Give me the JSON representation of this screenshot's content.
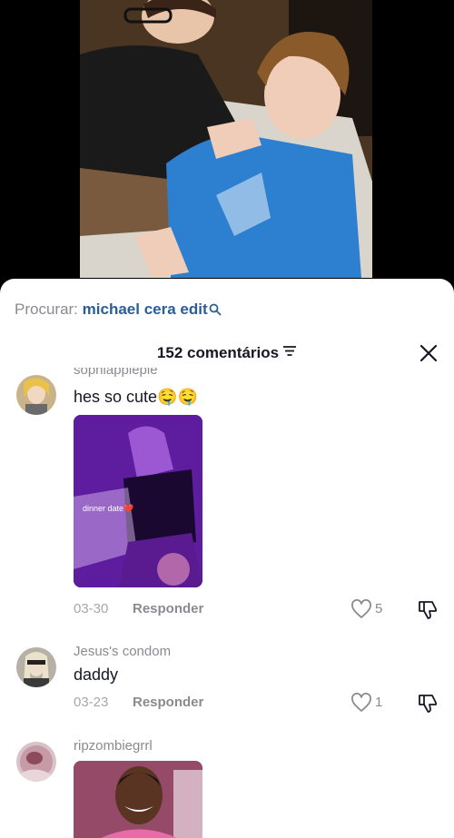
{
  "search": {
    "prefix": "Procurar:",
    "term": "michael cera edit"
  },
  "comments_header": {
    "title": "152 comentários"
  },
  "comments": [
    {
      "username": "sophiapplepie",
      "text": "hes so cute🤤🤤",
      "media_caption": "dinner date❤️",
      "date": "03-30",
      "reply_label": "Responder",
      "likes": "5"
    },
    {
      "username": "Jesus's condom",
      "text": "daddy",
      "date": "03-23",
      "reply_label": "Responder",
      "likes": "1"
    },
    {
      "username": "ripzombiegrrl"
    }
  ],
  "colors": {
    "accent": "#2b5d99",
    "secondary_text": "#8a8b91",
    "primary_text": "#161823"
  }
}
